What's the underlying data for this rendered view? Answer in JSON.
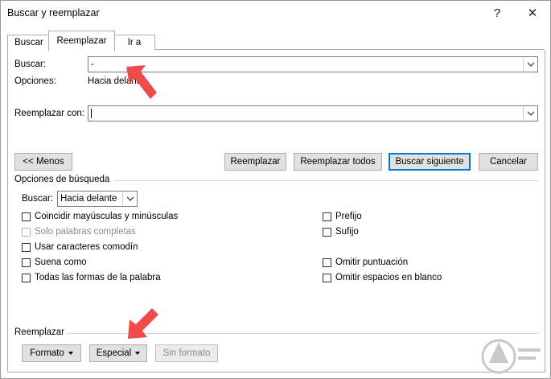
{
  "window": {
    "title": "Buscar y reemplazar",
    "help_glyph": "?",
    "close_glyph": "✕"
  },
  "tabs": [
    {
      "label": "Buscar",
      "active": false
    },
    {
      "label": "Reemplazar",
      "active": true
    },
    {
      "label": "Ir a",
      "active": false
    }
  ],
  "find": {
    "label": "Buscar:",
    "value": "-"
  },
  "options_summary": {
    "label": "Opciones:",
    "value": "Hacia delante"
  },
  "replace": {
    "label": "Reemplazar con:",
    "value": ""
  },
  "buttons": {
    "less": "<< Menos",
    "replace": "Reemplazar",
    "replace_all": "Reemplazar todos",
    "find_next": "Buscar siguiente",
    "cancel": "Cancelar"
  },
  "search_options": {
    "heading": "Opciones de búsqueda",
    "direction_label": "Buscar:",
    "direction_value": "Hacia delante",
    "left_checks": [
      {
        "label": "Coincidir mayúsculas y minúsculas",
        "checked": false,
        "enabled": true
      },
      {
        "label": "Solo palabras completas",
        "checked": false,
        "enabled": false
      },
      {
        "label": "Usar caracteres comodín",
        "checked": false,
        "enabled": true
      },
      {
        "label": "Suena como",
        "checked": false,
        "enabled": true
      },
      {
        "label": "Todas las formas de la palabra",
        "checked": false,
        "enabled": true
      }
    ],
    "right_checks": [
      {
        "label": "Prefijo",
        "checked": false,
        "enabled": true
      },
      {
        "label": "Sufijo",
        "checked": false,
        "enabled": true
      },
      {
        "label": "Omitir puntuación",
        "checked": false,
        "enabled": true
      },
      {
        "label": "Omitir espacios en blanco",
        "checked": false,
        "enabled": true
      }
    ]
  },
  "replace_section": {
    "heading": "Reemplazar",
    "format": "Formato",
    "special": "Especial",
    "no_format": "Sin formato"
  },
  "watermark_icon": "solvetic-logo-icon",
  "annotation_icon": "red-arrow-icon",
  "colors": {
    "accent": "#0078d7",
    "annotation": "#f04b4b",
    "watermark": "#c9c9c9"
  }
}
